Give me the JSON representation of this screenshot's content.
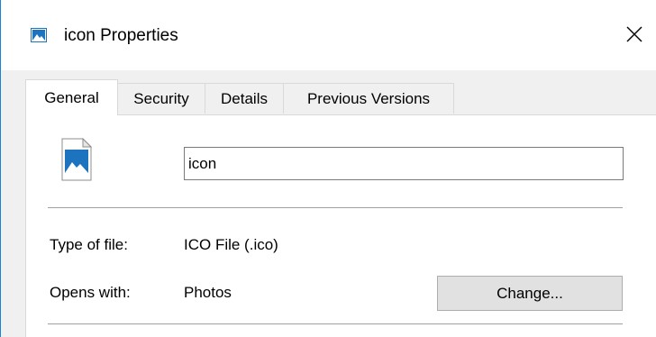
{
  "window": {
    "title": "icon Properties",
    "title_icon": "image-file-icon",
    "close_icon": "close-icon"
  },
  "tabs": [
    {
      "label": "General",
      "active": true
    },
    {
      "label": "Security",
      "active": false
    },
    {
      "label": "Details",
      "active": false
    },
    {
      "label": "Previous Versions",
      "active": false
    }
  ],
  "general": {
    "file_icon": "image-file-icon",
    "file_name": "icon",
    "type_label": "Type of file:",
    "type_value": "ICO File (.ico)",
    "opens_label": "Opens with:",
    "opens_value": "Photos",
    "change_label": "Change..."
  },
  "colors": {
    "accent": "#1883d7",
    "image_icon_blue": "#1e73be"
  }
}
